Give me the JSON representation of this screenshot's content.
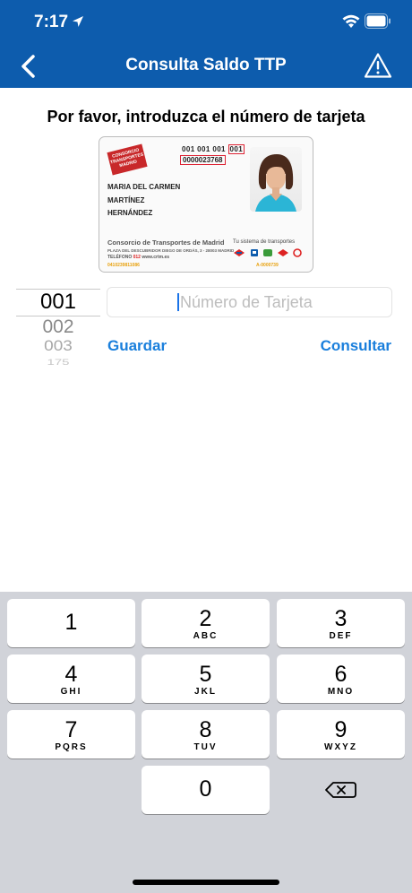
{
  "status": {
    "time": "7:17"
  },
  "nav": {
    "title": "Consulta Saldo TTP"
  },
  "prompt": "Por favor, introduzca el número de tarjeta",
  "card": {
    "logo_text": "CONSORCIO TRANSPORTES MADRID",
    "number_line1": "001 001 001",
    "number_line1_boxed": "001",
    "number_line2": "0000023768",
    "name_lines": [
      "MARIA DEL CARMEN",
      "MARTÍNEZ",
      "HERNÁNDEZ"
    ],
    "org": "Consorcio de Transportes de Madrid",
    "address": "PLAZA DEL DESCUBRIDOR DIEGO DE ORDÁS, 3 - 28003 MADRID",
    "tel_label": "TELÉFONO",
    "tel_number": "012",
    "web": "www.crtm.es",
    "system_label": "Tu sistema de transportes",
    "code_left": "0410239811086",
    "code_right": "A-0000739"
  },
  "picker": {
    "selected": "001",
    "options": [
      "002",
      "003",
      "175"
    ]
  },
  "input": {
    "placeholder": "Número de Tarjeta",
    "value": ""
  },
  "actions": {
    "save": "Guardar",
    "query": "Consultar"
  },
  "keyboard": {
    "keys": [
      {
        "digit": "1",
        "letters": ""
      },
      {
        "digit": "2",
        "letters": "ABC"
      },
      {
        "digit": "3",
        "letters": "DEF"
      },
      {
        "digit": "4",
        "letters": "GHI"
      },
      {
        "digit": "5",
        "letters": "JKL"
      },
      {
        "digit": "6",
        "letters": "MNO"
      },
      {
        "digit": "7",
        "letters": "PQRS"
      },
      {
        "digit": "8",
        "letters": "TUV"
      },
      {
        "digit": "9",
        "letters": "WXYZ"
      },
      {
        "digit": "0",
        "letters": ""
      }
    ]
  },
  "colors": {
    "header": "#0d5cad",
    "accent": "#1a7fdc",
    "keyboard_bg": "#d1d3d9"
  },
  "icons": [
    "location-arrow-icon",
    "wifi-icon",
    "battery-icon",
    "back-chevron-icon",
    "warning-icon",
    "backspace-icon"
  ]
}
